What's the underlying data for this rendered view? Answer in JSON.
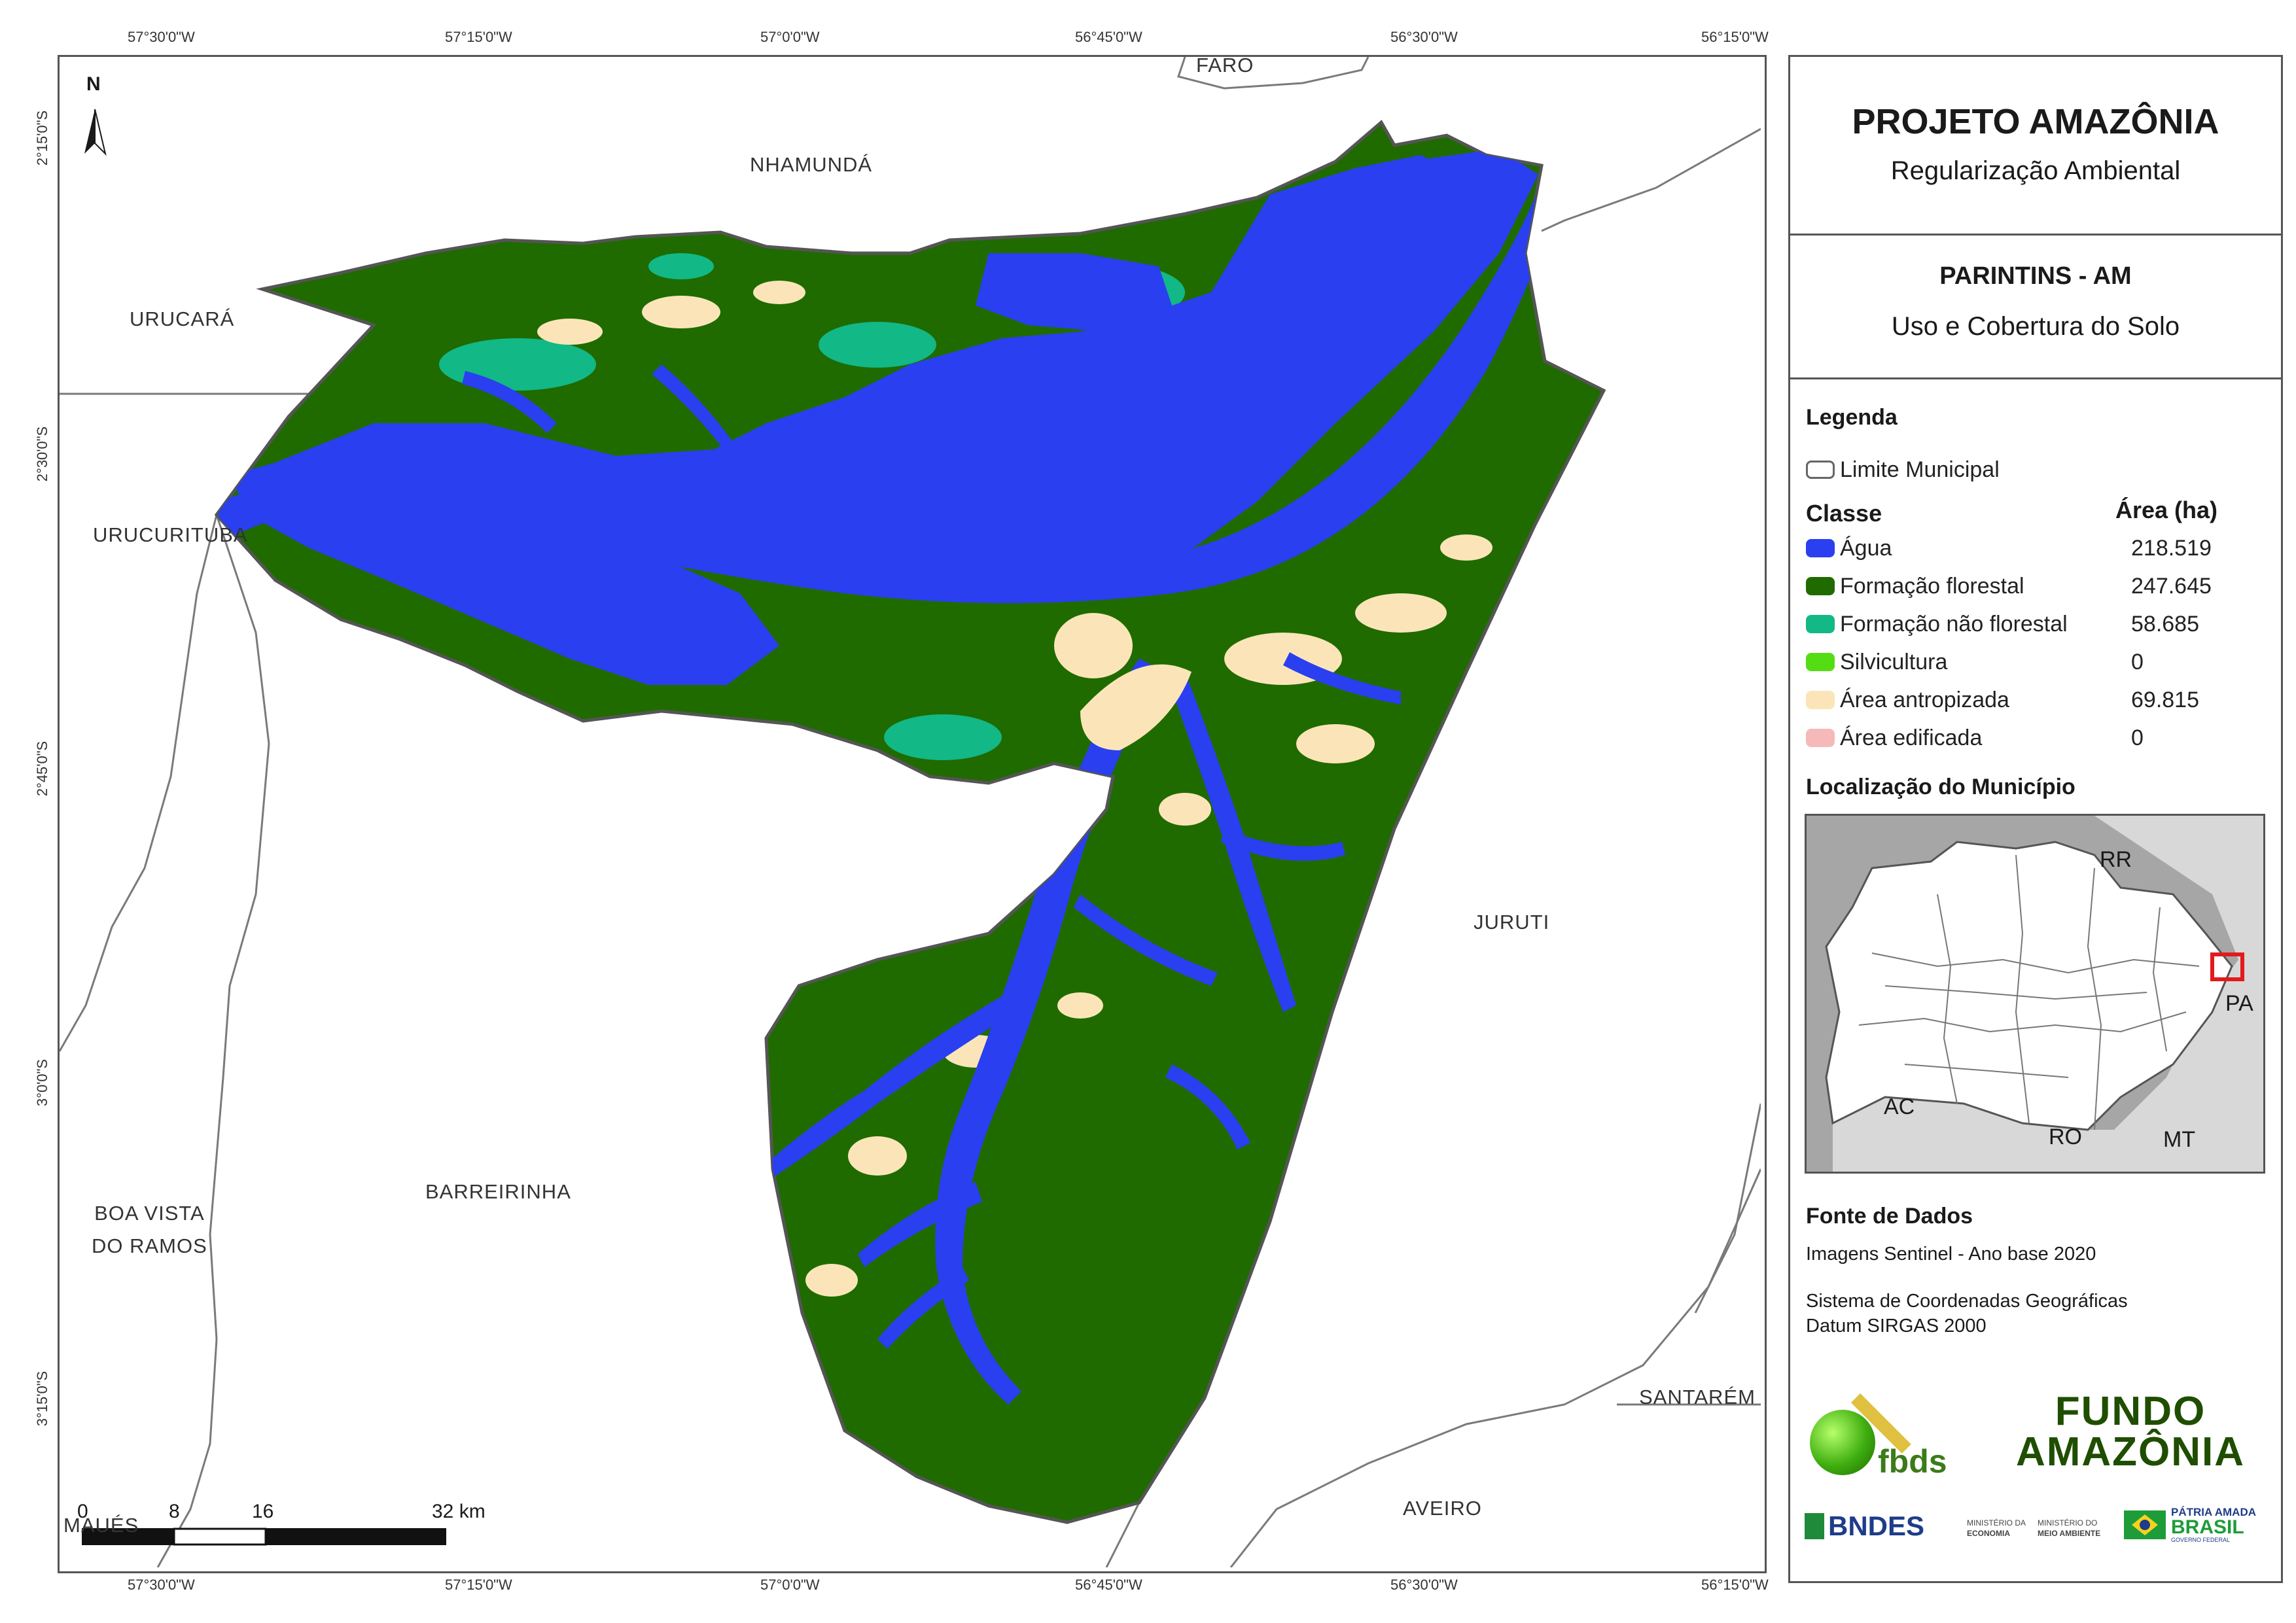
{
  "coords": {
    "top": [
      "57°30'0\"W",
      "57°15'0\"W",
      "57°0'0\"W",
      "56°45'0\"W",
      "56°30'0\"W",
      "56°15'0\"W"
    ],
    "bottom": [
      "57°30'0\"W",
      "57°15'0\"W",
      "57°0'0\"W",
      "56°45'0\"W",
      "56°30'0\"W",
      "56°15'0\"W"
    ],
    "left": [
      "2°15'0\"S",
      "2°30'0\"S",
      "2°45'0\"S",
      "3°0'0\"S",
      "3°15'0\"S"
    ]
  },
  "north_arrow": {
    "label": "N"
  },
  "municipalities": {
    "faro": "FARO",
    "nhamunda": "NHAMUNDÁ",
    "urucara": "URUCARÁ",
    "urucurituba": "URUCURITUBA",
    "juruti": "JURUTI",
    "barreirinha": "BARREIRINHA",
    "boa_vista": [
      "BOA VISTA",
      "DO RAMOS"
    ],
    "santarem": "SANTARÉM",
    "aveiro": "AVEIRO",
    "maues": "MAUÉS"
  },
  "scale_bar": {
    "labels": [
      "0",
      "8",
      "16",
      "32 km"
    ]
  },
  "panel": {
    "project_title": "PROJETO AMAZÔNIA",
    "project_subtitle": "Regularização Ambiental",
    "map_title": "PARINTINS - AM",
    "map_subtitle": "Uso e Cobertura do Solo",
    "legend_title": "Legenda",
    "limit_label": "Limite Municipal",
    "class_header": "Classe",
    "area_header": "Área (ha)",
    "classes": [
      {
        "label": "Água",
        "value": "218.519",
        "color": "#2a3ff0"
      },
      {
        "label": "Formação florestal",
        "value": "247.645",
        "color": "#1f6b00"
      },
      {
        "label": "Formação não florestal",
        "value": "58.685",
        "color": "#12b886"
      },
      {
        "label": "Silvicultura",
        "value": "0",
        "color": "#55dd14"
      },
      {
        "label": "Área antropizada",
        "value": "69.815",
        "color": "#fbe5b8"
      },
      {
        "label": "Área edificada",
        "value": "0",
        "color": "#f6b9b9"
      }
    ],
    "location_title": "Localização do Município",
    "inset_labels": {
      "rr": "RR",
      "pa": "PA",
      "ac": "AC",
      "ro": "RO",
      "mt": "MT"
    },
    "source_title": "Fonte de Dados",
    "source_line1": "Imagens Sentinel - Ano base 2020",
    "source_line2": "Sistema de Coordenadas Geográficas",
    "source_line3": "Datum SIRGAS 2000"
  },
  "logos": {
    "fbds": "fbds",
    "fundo_line1": "FUNDO",
    "fundo_line2": "AMAZÔNIA",
    "bndes": "BNDES",
    "min_economia": [
      "MINISTÉRIO DA",
      "ECONOMIA"
    ],
    "min_ambiente": [
      "MINISTÉRIO DO",
      "MEIO AMBIENTE"
    ],
    "patria_line1": "PÁTRIA AMADA",
    "patria_line2": "BRASIL",
    "patria_line3": "GOVERNO FEDERAL"
  }
}
